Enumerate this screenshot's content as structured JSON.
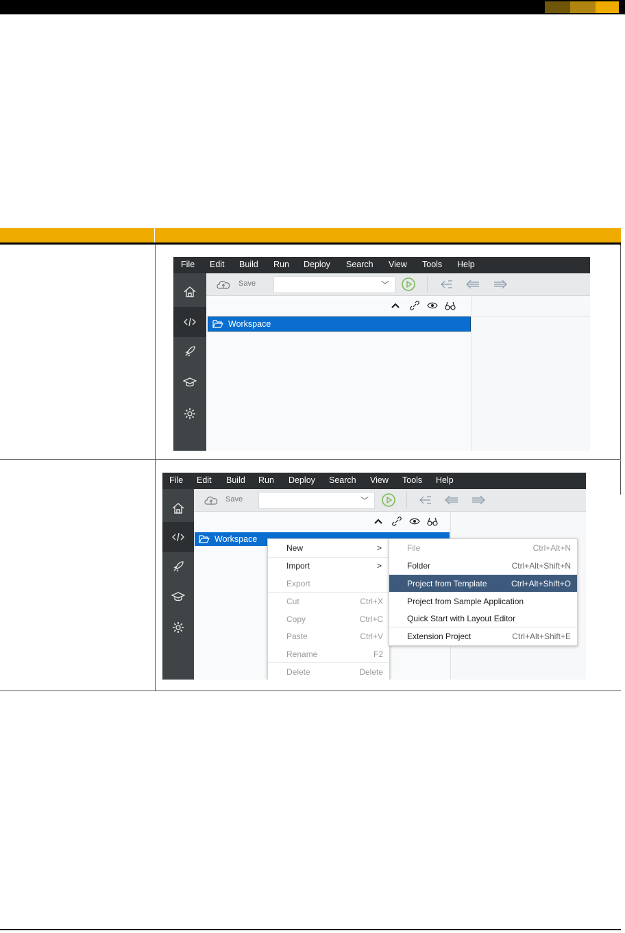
{
  "banner": {
    "swatches": [
      "#6f5508",
      "#b08410",
      "#f0ab00"
    ]
  },
  "table": {
    "header_color": "#f0ab00"
  },
  "ide": {
    "menu": [
      "File",
      "Edit",
      "Build",
      "Run",
      "Deploy",
      "Search",
      "View",
      "Tools",
      "Help"
    ],
    "toolbar": {
      "save_label": "Save"
    },
    "sidebar_icons": [
      "home-icon",
      "code-icon",
      "rocket-icon",
      "learning-icon",
      "settings-icon"
    ],
    "tree_tools": [
      "collapse-icon",
      "link-icon",
      "eye-icon",
      "binoculars-icon"
    ],
    "workspace_label": "Workspace",
    "accent": "#0a6ed1",
    "highlight": "#3d5a7c"
  },
  "context_menu": {
    "items": [
      {
        "label": "New",
        "shortcut": ">"
      },
      {
        "label": "Import",
        "shortcut": ">"
      },
      {
        "label": "Export",
        "shortcut": ""
      },
      {
        "label": "Cut",
        "shortcut": "Ctrl+X"
      },
      {
        "label": "Copy",
        "shortcut": "Ctrl+C"
      },
      {
        "label": "Paste",
        "shortcut": "Ctrl+V"
      },
      {
        "label": "Rename",
        "shortcut": "F2"
      },
      {
        "label": "Delete",
        "shortcut": "Delete"
      }
    ]
  },
  "submenu": {
    "items": [
      {
        "label": "File",
        "shortcut": "Ctrl+Alt+N"
      },
      {
        "label": "Folder",
        "shortcut": "Ctrl+Alt+Shift+N"
      },
      {
        "label": "Project from Template",
        "shortcut": "Ctrl+Alt+Shift+O"
      },
      {
        "label": "Project from Sample Application",
        "shortcut": ""
      },
      {
        "label": "Quick Start with Layout Editor",
        "shortcut": ""
      },
      {
        "label": "Extension Project",
        "shortcut": "Ctrl+Alt+Shift+E"
      }
    ]
  }
}
